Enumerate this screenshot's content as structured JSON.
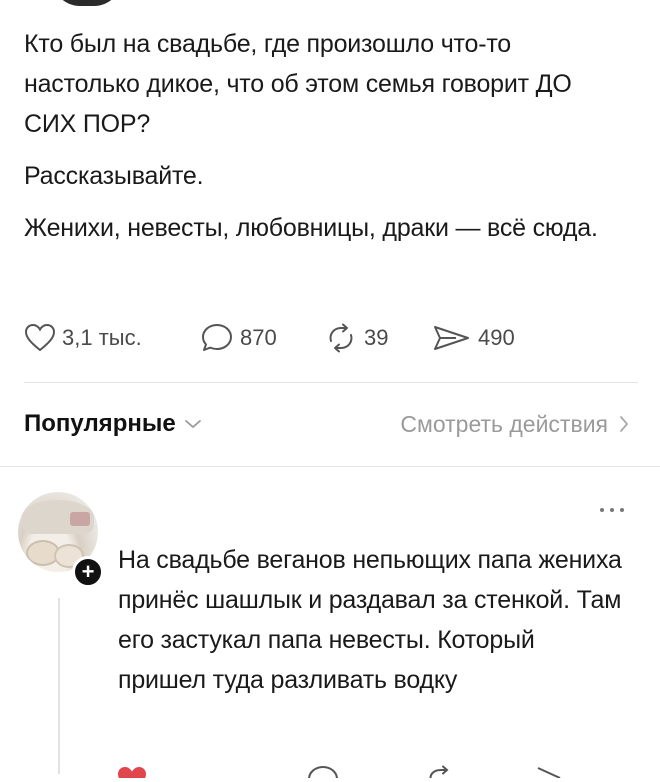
{
  "post": {
    "paragraphs": [
      "Кто был на свадьбе, где произошло что-то настолько дикое, что об этом семья говорит ДО СИХ ПОР?",
      "Рассказывайте.",
      "Женихи, невесты, любовницы, драки — всё сюда."
    ]
  },
  "actions": {
    "likes": "3,1 тыс.",
    "comments": "870",
    "reposts": "39",
    "shares": "490"
  },
  "sort": {
    "label": "Популярные",
    "view_activity": "Смотреть действия"
  },
  "comment": {
    "text": "На свадьбе веганов непьющих папа жениха принёс шашлык и раздавал за стенкой. Там его застукал папа невесты. Который пришел туда разливать водку",
    "follow_symbol": "+"
  },
  "icons": {
    "like": "heart-icon",
    "comment": "speech-bubble-icon",
    "repost": "repost-arrows-icon",
    "share": "send-arrow-icon",
    "sort_dropdown": "chevron-down-icon",
    "view_more": "chevron-right-icon",
    "more": "more-dots-icon"
  },
  "colors": {
    "text": "#1a1a1a",
    "muted": "#9a9a9a",
    "like_red": "#e0474c"
  }
}
